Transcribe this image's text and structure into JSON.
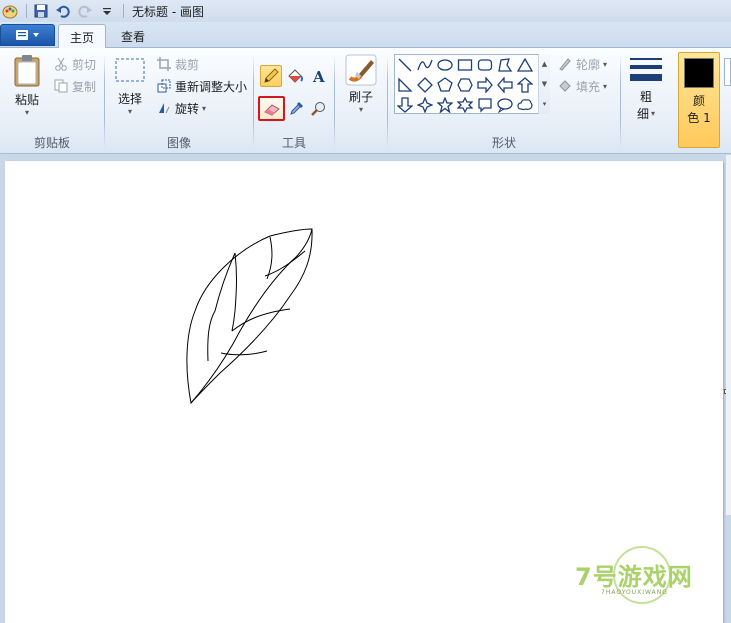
{
  "window": {
    "title": "无标题 - 画图"
  },
  "tabs": [
    {
      "label": "主页",
      "active": true
    },
    {
      "label": "查看",
      "active": false
    }
  ],
  "clipboard": {
    "paste_label": "粘贴",
    "cut_label": "剪切",
    "copy_label": "复制",
    "group_label": "剪贴板"
  },
  "image": {
    "select_label": "选择",
    "crop_label": "裁剪",
    "resize_label": "重新调整大小",
    "rotate_label": "旋转",
    "group_label": "图像"
  },
  "tools": {
    "group_label": "工具",
    "items": [
      "pencil-icon",
      "fill-icon",
      "text-icon",
      "eraser-icon",
      "color-picker-icon",
      "magnifier-icon"
    ],
    "highlight_color": "#d9141c"
  },
  "brushes": {
    "label": "刷子"
  },
  "shapes": {
    "group_label": "形状",
    "outline_label": "轮廓",
    "fill_label": "填充"
  },
  "size": {
    "label_line1": "粗",
    "label_line2": "细"
  },
  "colors": {
    "color1_line1": "颜",
    "color1_line2": "色 1",
    "color1_value": "#000000",
    "accent": "#ffcf5c"
  },
  "watermark": {
    "text": "7号游戏网",
    "sub": "7HAOYOUXIWANG"
  }
}
